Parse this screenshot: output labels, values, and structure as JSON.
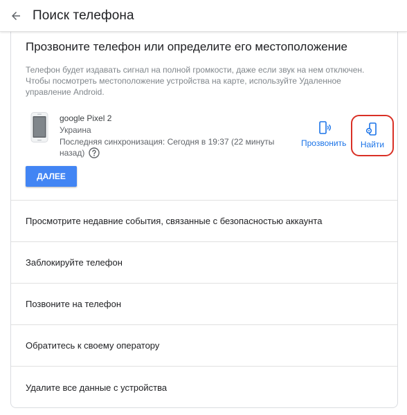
{
  "header": {
    "title": "Поиск телефона",
    "back_icon": "arrow-back-icon"
  },
  "main": {
    "heading": "Прозвоните телефон или определите его местоположение",
    "description": "Телефон будет издавать сигнал на полной громкости, даже если звук на нем отключен. Чтобы посмотреть местоположение устройства на карте, используйте Удаленное управление Android.",
    "device": {
      "name": "google Pixel 2",
      "country": "Украина",
      "last_sync": "Последняя синхронизация: Сегодня в 19:37 (22 минуты назад)"
    },
    "actions": {
      "ring_label": "Прозвонить",
      "find_label": "Найти"
    },
    "next_label": "ДАЛЕЕ"
  },
  "list_items": [
    "Просмотрите недавние события, связанные с безопасностью аккаунта",
    "Заблокируйте телефон",
    "Позвоните на телефон",
    "Обратитесь к своему оператору",
    "Удалите все данные с устройства"
  ],
  "colors": {
    "accent": "#1a73e8",
    "button": "#4285f4",
    "highlight": "#d93025"
  }
}
